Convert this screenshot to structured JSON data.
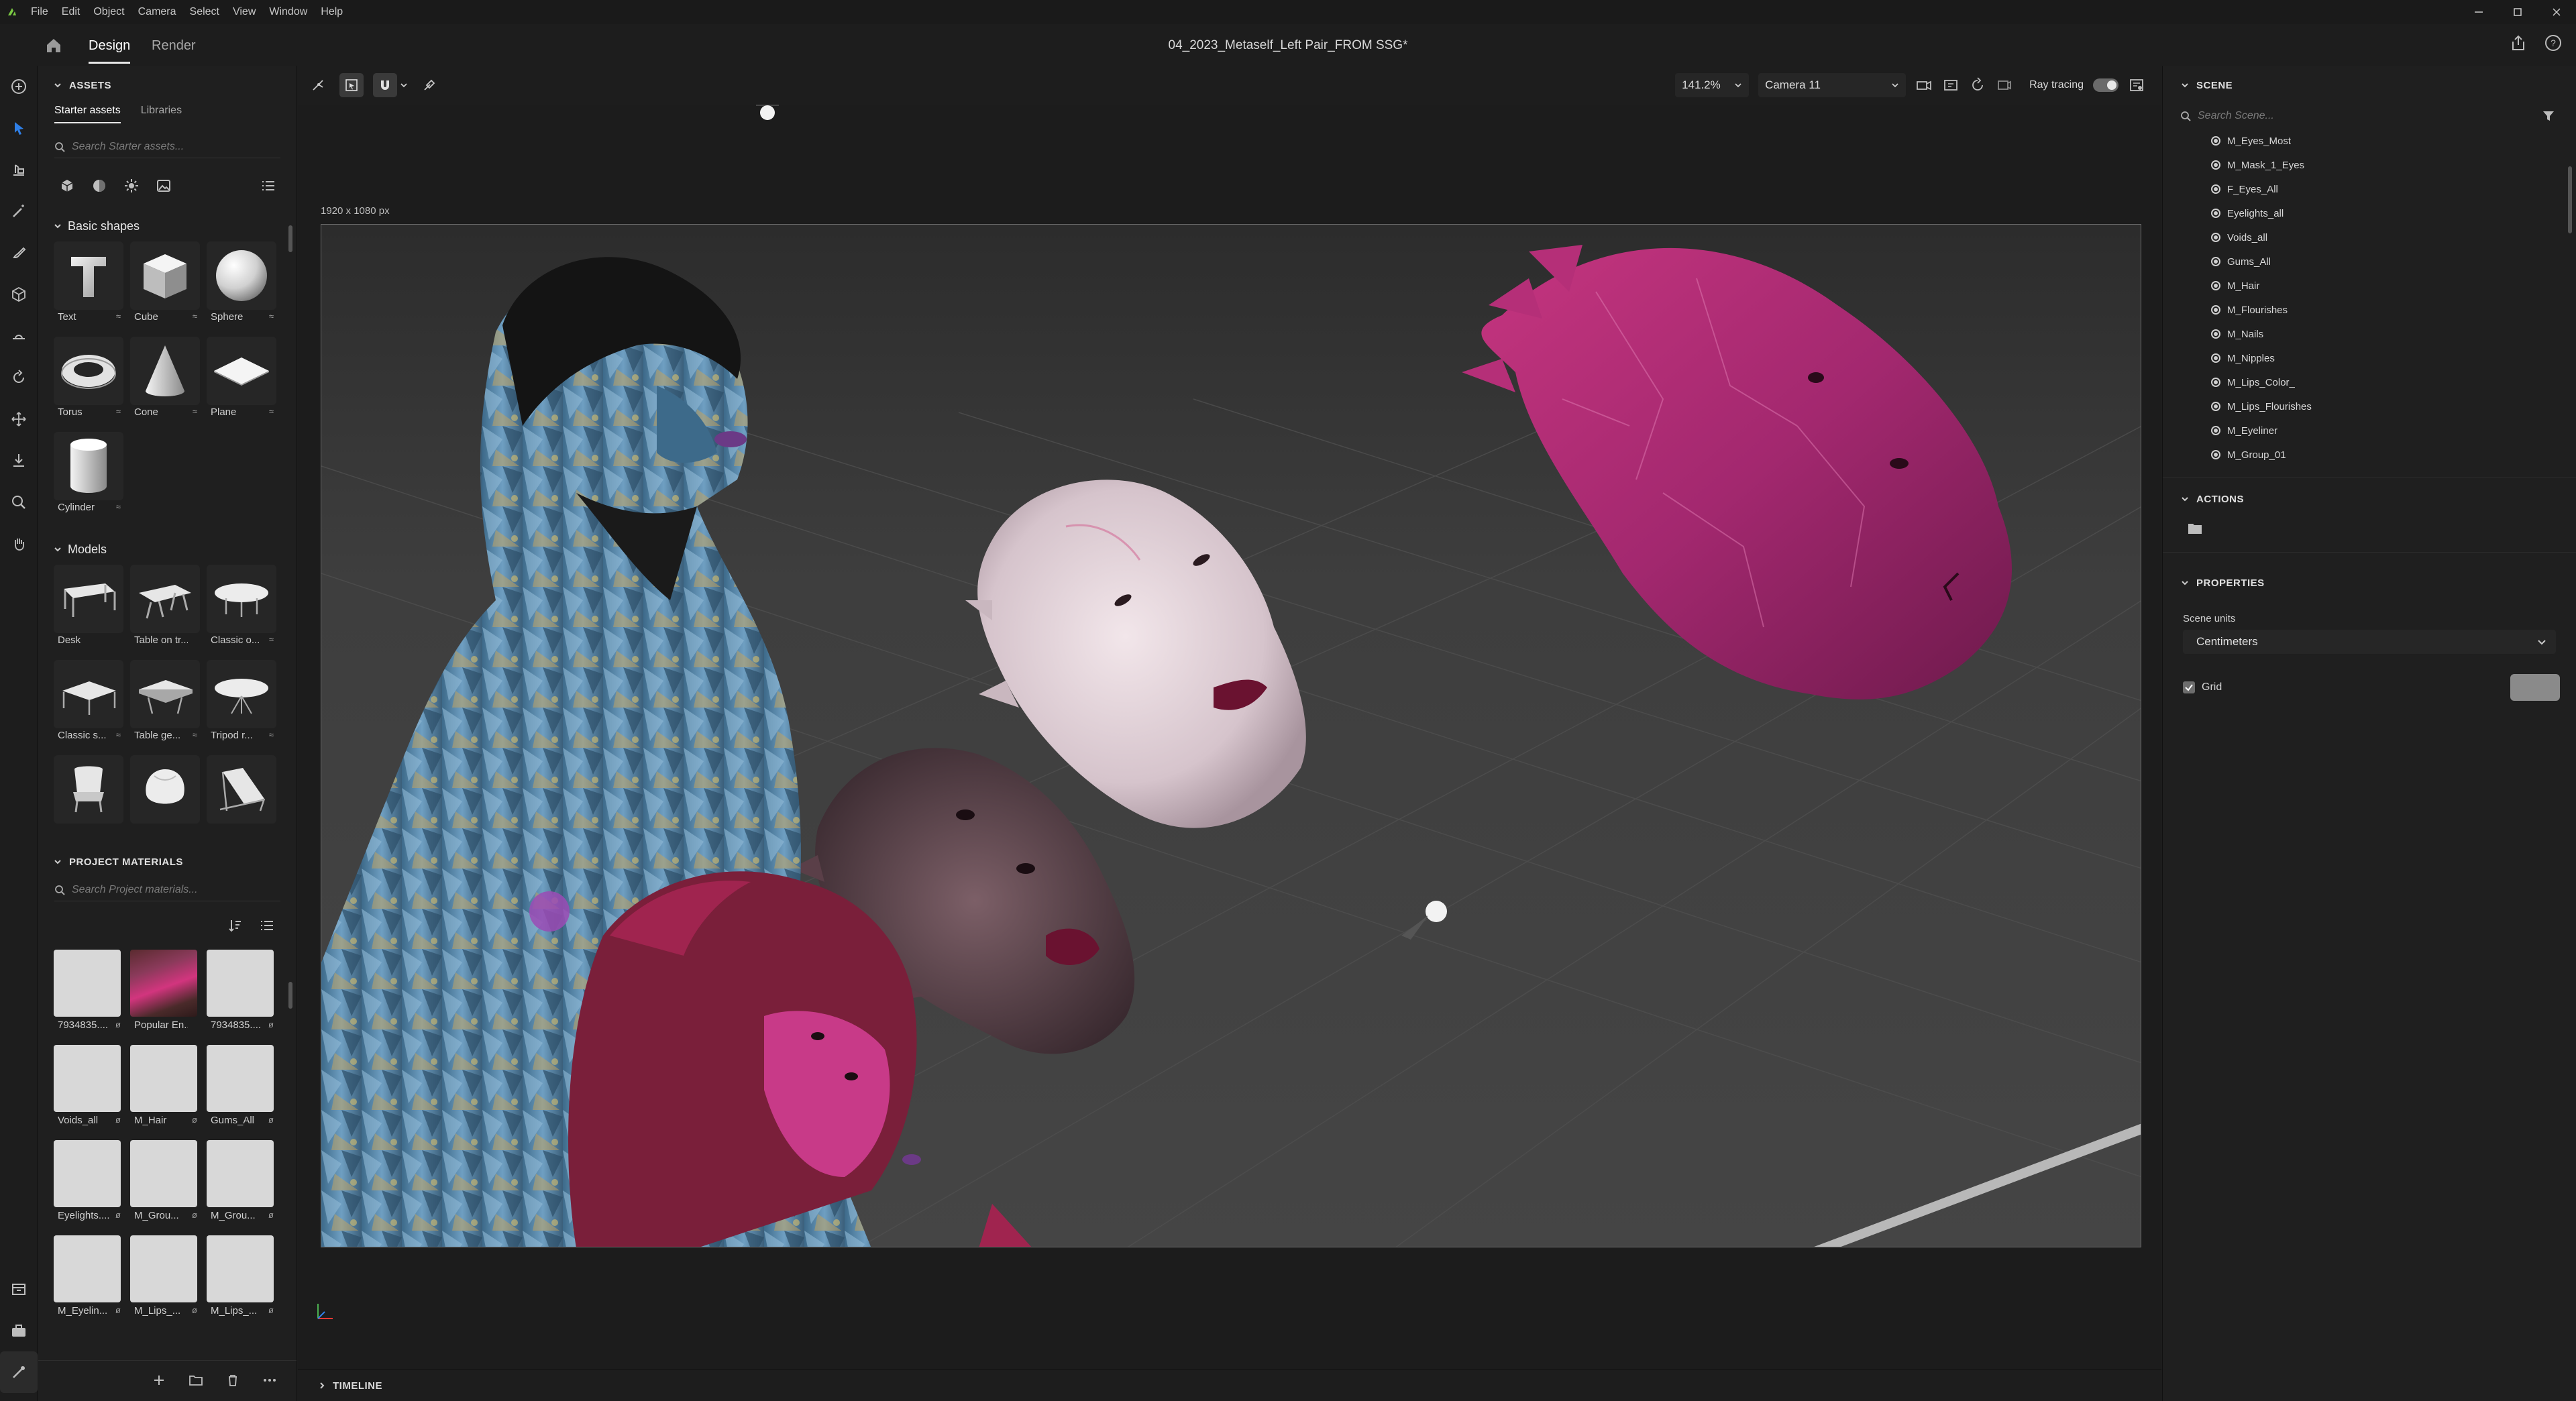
{
  "menubar": {
    "items": [
      "File",
      "Edit",
      "Object",
      "Camera",
      "Select",
      "View",
      "Window",
      "Help"
    ]
  },
  "appbar": {
    "tabs": [
      "Design",
      "Render"
    ],
    "active_tab": "Design",
    "document_title": "04_2023_Metaself_Left Pair_FROM SSG*"
  },
  "assets": {
    "header": "ASSETS",
    "subtabs": [
      "Starter assets",
      "Libraries"
    ],
    "search_placeholder": "Search Starter assets...",
    "basic_shapes": {
      "title": "Basic shapes",
      "items": [
        "Text",
        "Cube",
        "Sphere",
        "Torus",
        "Cone",
        "Plane",
        "Cylinder"
      ]
    },
    "models": {
      "title": "Models",
      "items": [
        "Desk",
        "Table on tr...",
        "Classic o...",
        "Classic s...",
        "Table ge...",
        "Tripod r..."
      ]
    }
  },
  "project_materials": {
    "header": "PROJECT MATERIALS",
    "search_placeholder": "Search Project materials...",
    "items": [
      "7934835....",
      "Popular En...",
      "7934835....",
      "Voids_all",
      "M_Hair",
      "Gums_All",
      "Eyelights....",
      "M_Grou...",
      "M_Grou...",
      "M_Eyelin...",
      "M_Lips_...",
      "M_Lips_..."
    ]
  },
  "viewport": {
    "zoom": "141.2%",
    "camera": "Camera 11",
    "ray_tracing_label": "Ray tracing",
    "ray_tracing_on": true,
    "resolution_label": "1920 x 1080 px"
  },
  "timeline": {
    "label": "TIMELINE"
  },
  "scene": {
    "header": "SCENE",
    "search_placeholder": "Search Scene...",
    "items": [
      "M_Eyes_Most",
      "M_Mask_1_Eyes",
      "F_Eyes_All",
      "Eyelights_all",
      "Voids_all",
      "Gums_All",
      "M_Hair",
      "M_Flourishes",
      "M_Nails",
      "M_Nipples",
      "M_Lips_Color_",
      "M_Lips_Flourishes",
      "M_Eyeliner",
      "M_Group_01"
    ]
  },
  "actions": {
    "header": "ACTIONS"
  },
  "properties": {
    "header": "PROPERTIES",
    "scene_units_label": "Scene units",
    "scene_units_value": "Centimeters",
    "grid_label": "Grid",
    "grid_checked": true
  },
  "colors": {
    "accent_logo": "#7ac943",
    "background": "#1d1d1d",
    "panel": "#1f1f1f",
    "viewport_floor": "#3b3b3b",
    "magenta_head": "#a3286f",
    "blue_figure": "#5b8fb5"
  }
}
